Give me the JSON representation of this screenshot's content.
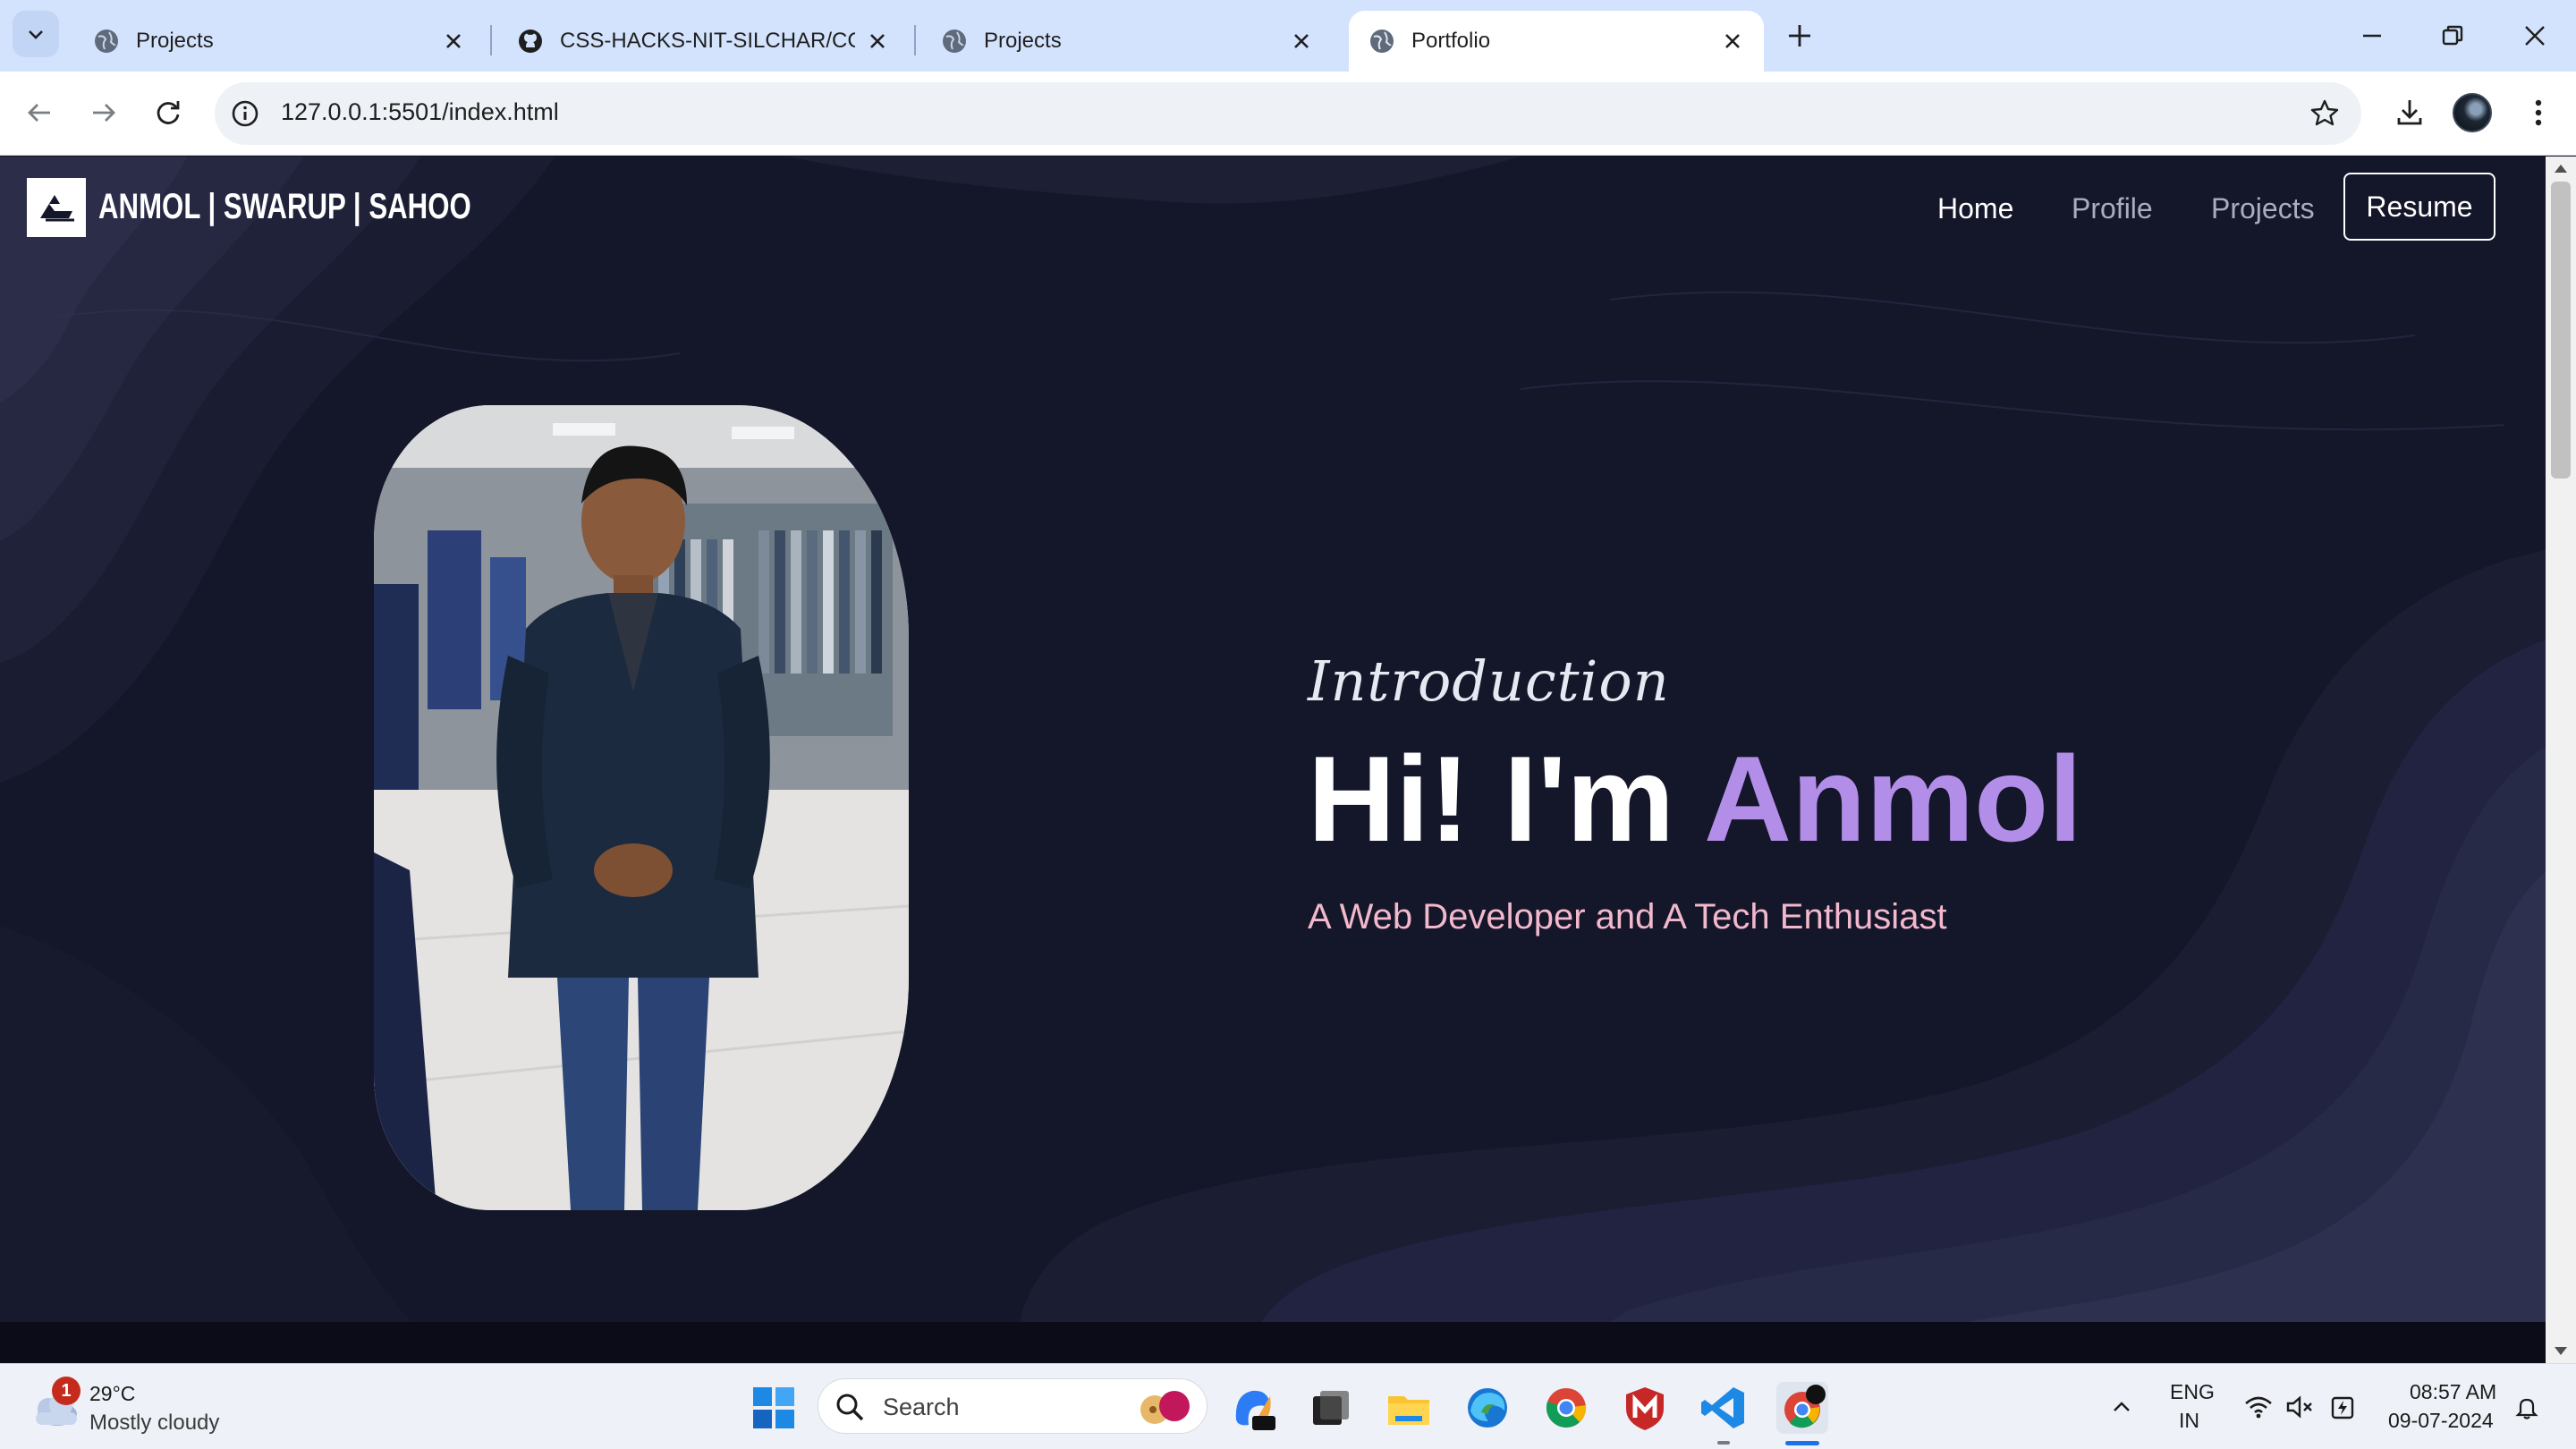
{
  "browser": {
    "tabs": [
      {
        "title": "Projects",
        "icon": "globe-icon",
        "active": false
      },
      {
        "title": "CSS-HACKS-NIT-SILCHAR/CCS",
        "icon": "github-icon",
        "active": false
      },
      {
        "title": "Projects",
        "icon": "globe-icon",
        "active": false
      },
      {
        "title": "Portfolio",
        "icon": "globe-icon",
        "active": true
      }
    ],
    "url": "127.0.0.1:5501/index.html"
  },
  "site": {
    "logo_text": "ANMOL | SWARUP | SAHOO",
    "nav": [
      {
        "label": "Home",
        "current": true
      },
      {
        "label": "Profile",
        "current": false
      },
      {
        "label": "Projects",
        "current": false
      }
    ],
    "resume_label": "Resume",
    "hero": {
      "intro": "Introduction",
      "greeting": "Hi! I'm",
      "name": "Anmol",
      "subtitle": "A Web Developer and A Tech Enthusiast"
    }
  },
  "colors": {
    "name_accent": "#b38ee8",
    "subtitle": "#f2b8cc",
    "page_bg": "#14162a"
  },
  "taskbar": {
    "weather": {
      "badge": "1",
      "temp": "29°C",
      "desc": "Mostly cloudy"
    },
    "search_label": "Search",
    "language": {
      "line1": "ENG",
      "line2": "IN"
    },
    "clock": {
      "time": "08:57 AM",
      "date": "09-07-2024"
    },
    "apps": [
      "windows-start-icon",
      "copilot-icon",
      "task-view-icon",
      "file-explorer-icon",
      "edge-icon",
      "chrome-icon",
      "mcafee-icon",
      "vscode-icon",
      "chrome-profile-icon"
    ]
  }
}
